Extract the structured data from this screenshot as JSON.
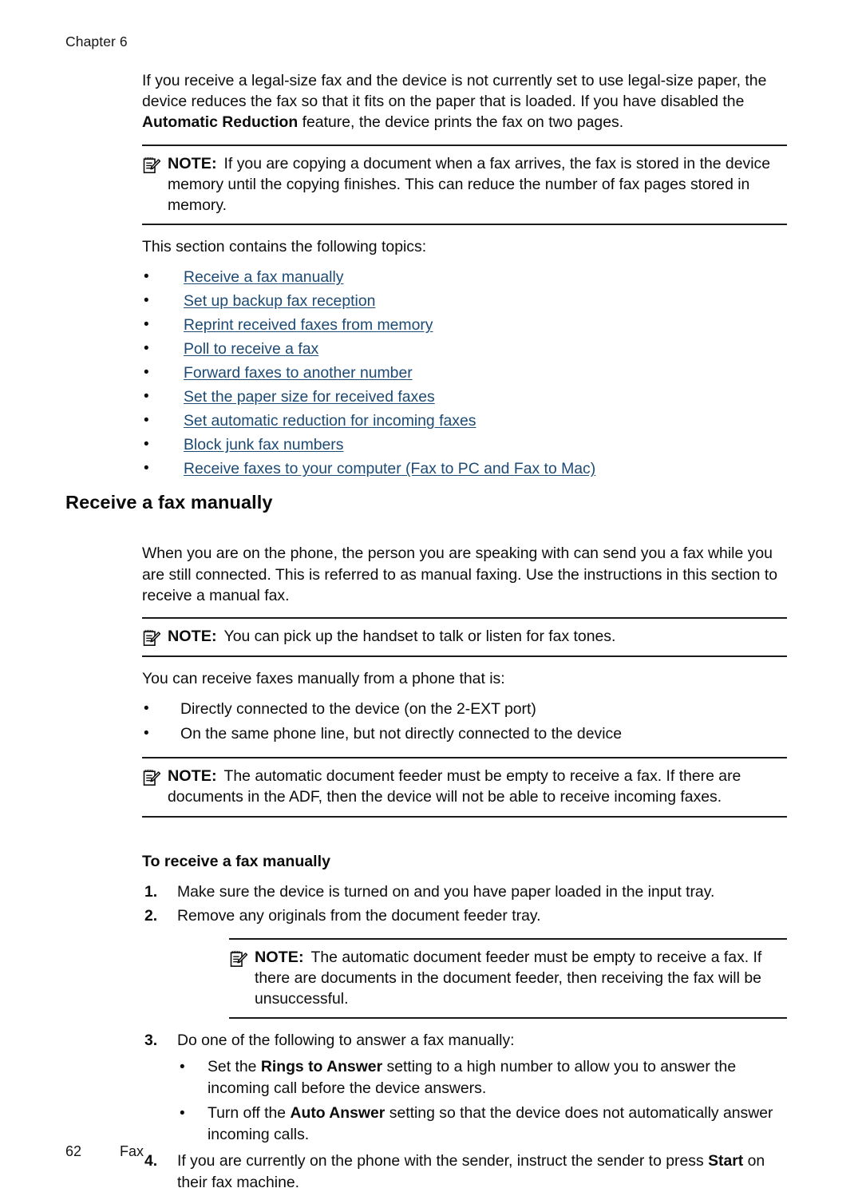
{
  "header": {
    "chapter": "Chapter 6"
  },
  "intro": {
    "paragraph_part1": "If you receive a legal-size fax and the device is not currently set to use legal-size paper, the device reduces the fax so that it fits on the paper that is loaded. If you have disabled the ",
    "paragraph_bold": "Automatic Reduction",
    "paragraph_part2": " feature, the device prints the fax on two pages."
  },
  "note1": {
    "icon": "note-pencil-icon",
    "label": "NOTE:",
    "text": "If you are copying a document when a fax arrives, the fax is stored in the device memory until the copying finishes. This can reduce the number of fax pages stored in memory."
  },
  "topics": {
    "lead_in": "This section contains the following topics:",
    "bullet_glyph": "•",
    "links": [
      "Receive a fax manually",
      "Set up backup fax reception",
      "Reprint received faxes from memory",
      "Poll to receive a fax",
      "Forward faxes to another number",
      "Set the paper size for received faxes",
      "Set automatic reduction for incoming faxes",
      "Block junk fax numbers",
      "Receive faxes to your computer (Fax to PC and Fax to Mac)"
    ]
  },
  "section": {
    "title": "Receive a fax manually",
    "intro": "When you are on the phone, the person you are speaking with can send you a fax while you are still connected. This is referred to as manual faxing. Use the instructions in this section to receive a manual fax."
  },
  "note2": {
    "icon": "note-pencil-icon",
    "label": "NOTE:",
    "text": "You can pick up the handset to talk or listen for fax tones."
  },
  "phone_list": {
    "lead_in": "You can receive faxes manually from a phone that is:",
    "bullet_glyph": "•",
    "items": [
      "Directly connected to the device (on the 2-EXT port)",
      "On the same phone line, but not directly connected to the device"
    ]
  },
  "note3": {
    "icon": "note-pencil-icon",
    "label": "NOTE:",
    "text": "The automatic document feeder must be empty to receive a fax. If there are documents in the ADF, then the device will not be able to receive incoming faxes."
  },
  "procedure": {
    "title": "To receive a fax manually",
    "steps": [
      {
        "number": "1.",
        "text": "Make sure the device is turned on and you have paper loaded in the input tray."
      },
      {
        "number": "2.",
        "text": "Remove any originals from the document feeder tray."
      },
      {
        "number": "3.",
        "text": "Do one of the following to answer a fax manually:"
      },
      {
        "number": "4.",
        "text_part1": "If you are currently on the phone with the sender, instruct the sender to press ",
        "text_bold": "Start",
        "text_part2": " on their fax machine."
      }
    ],
    "step3_bullets": [
      {
        "part1": "Set the ",
        "bold": "Rings to Answer",
        "part2": " setting to a high number to allow you to answer the incoming call before the device answers."
      },
      {
        "part1": "Turn off the ",
        "bold": "Auto Answer",
        "part2": " setting so that the device does not automatically answer incoming calls."
      }
    ],
    "bullet_glyph": "•"
  },
  "note4": {
    "icon": "note-pencil-icon",
    "label": "NOTE:",
    "text": "The automatic document feeder must be empty to receive a fax. If there are documents in the document feeder, then receiving the fax will be unsuccessful."
  },
  "footer": {
    "page_number": "62",
    "label": "Fax"
  },
  "colors": {
    "link": "#1d4a73",
    "text": "#0d0d0d",
    "rule": "#1a1a1a",
    "background": "#ffffff"
  }
}
